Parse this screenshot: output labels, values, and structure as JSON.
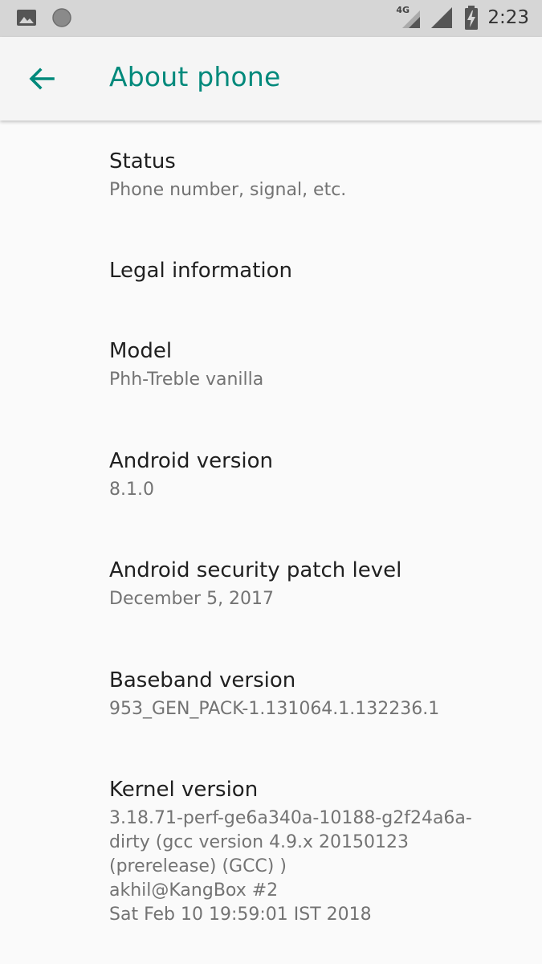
{
  "status_bar": {
    "time": "2:23",
    "network_type": "4G",
    "icons": [
      "image-notification-icon",
      "circle-notification-icon",
      "signal-4g-icon",
      "signal-icon",
      "battery-charging-icon"
    ]
  },
  "toolbar": {
    "title": "About phone",
    "accent_color": "#00897b"
  },
  "items": [
    {
      "title": "Status",
      "summary": "Phone number, signal, etc."
    },
    {
      "title": "Legal information",
      "summary": ""
    },
    {
      "title": "Model",
      "summary": "Phh-Treble vanilla"
    },
    {
      "title": "Android version",
      "summary": "8.1.0"
    },
    {
      "title": "Android security patch level",
      "summary": "December 5, 2017"
    },
    {
      "title": "Baseband version",
      "summary": "953_GEN_PACK-1.131064.1.132236.1"
    },
    {
      "title": "Kernel version",
      "summary": "3.18.71-perf-ge6a340a-10188-g2f24a6a-\ndirty (gcc version 4.9.x 20150123\n(prerelease) (GCC) )\nakhil@KangBox #2\nSat Feb 10 19:59:01 IST 2018"
    }
  ]
}
